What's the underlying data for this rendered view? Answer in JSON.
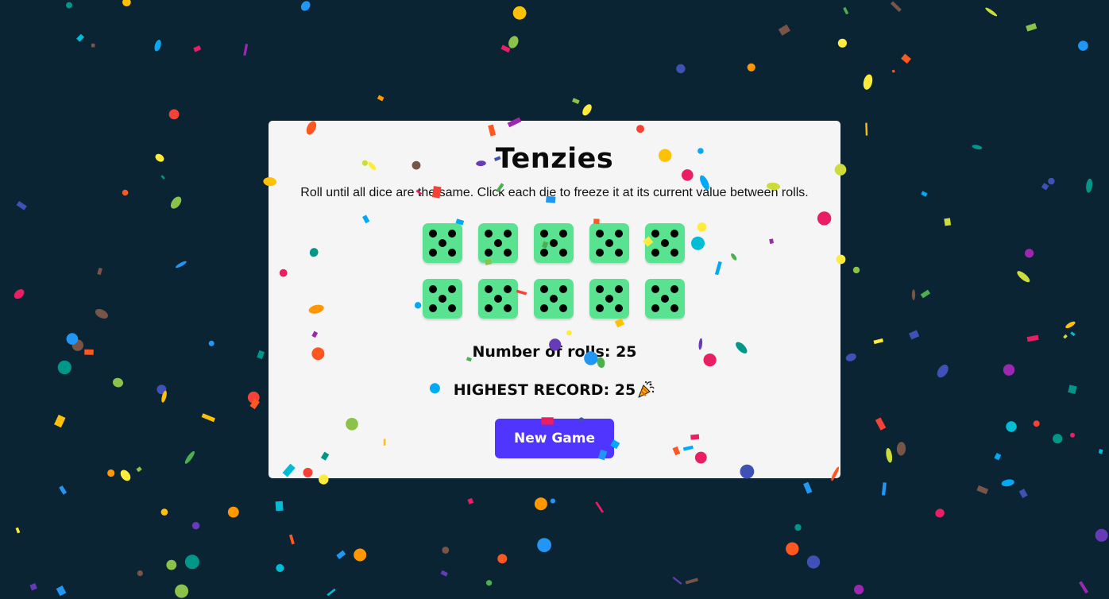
{
  "game": {
    "title": "Tenzies",
    "instructions": "Roll until all dice are the same. Click each die to freeze it at its current value between rolls.",
    "dice": [
      5,
      5,
      5,
      5,
      5,
      5,
      5,
      5,
      5,
      5
    ],
    "die_held_color": "#59e391",
    "rolls_text": "Number of rolls: 25",
    "record_text": "HIGHEST RECORD: 25",
    "record_icon": "party-popper-icon",
    "new_game_label": "New Game",
    "button_color": "#5035ff"
  },
  "background_color": "#0b2434",
  "confetti_colors": [
    "#f44336",
    "#e91e63",
    "#9c27b0",
    "#673ab7",
    "#3f51b5",
    "#2196f3",
    "#03a9f4",
    "#00bcd4",
    "#009688",
    "#4caf50",
    "#8bc34a",
    "#cddc39",
    "#ffeb3b",
    "#ffc107",
    "#ff9800",
    "#ff5722",
    "#795548"
  ]
}
